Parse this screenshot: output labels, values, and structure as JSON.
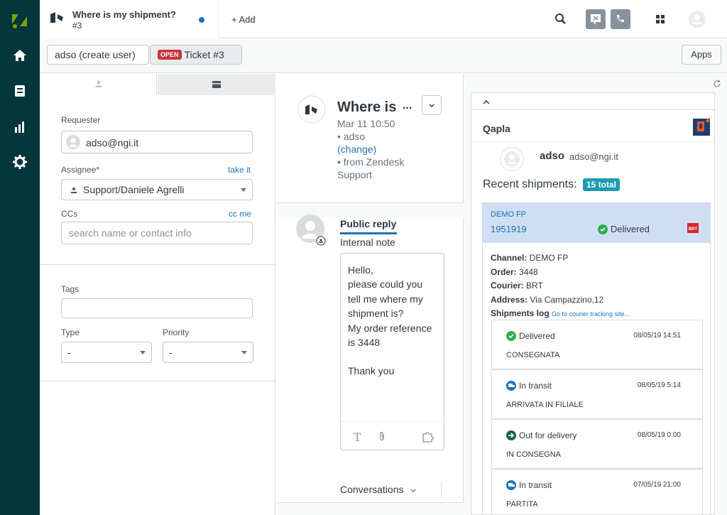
{
  "topbar": {
    "tab_title": "Where is my shipment?",
    "tab_number": "#3",
    "add_label": "+ Add"
  },
  "subbar": {
    "user_crumb": "adso (create user)",
    "open_badge": "OPEN",
    "ticket_crumb": "Ticket #3",
    "apps_label": "Apps"
  },
  "left": {
    "requester_label": "Requester",
    "requester_value": "adso@ngi.it",
    "assignee_label": "Assignee*",
    "take_it": "take it",
    "assignee_value": "Support/Daniele Agrelli",
    "ccs_label": "CCs",
    "cc_me": "cc me",
    "ccs_placeholder": "search name or contact info",
    "tags_label": "Tags",
    "type_label": "Type",
    "type_value": "-",
    "priority_label": "Priority",
    "priority_value": "-"
  },
  "middle": {
    "title": "Where is",
    "title_more": "...",
    "date": "Mar 11 10:50",
    "author": "• adso",
    "change": "(change)",
    "via": "• from Zendesk",
    "via2": "Support",
    "public_reply": "Public reply",
    "internal_note": "Internal note",
    "message_lines": [
      "Hello,",
      "please could you",
      "tell me where my",
      "shipment is?",
      "My order reference",
      "is 3448",
      "",
      "Thank you"
    ],
    "conversations": "Conversations"
  },
  "app": {
    "name": "Qapla",
    "user_name": "adso",
    "user_email": "adso@ngi.it",
    "recent_label": "Recent shipments:",
    "total_badge": "15 total",
    "shop": "DEMO FP",
    "tracking": "1951919",
    "status": "Delivered",
    "courier_logo": "BRT",
    "channel_label": "Channel:",
    "channel_value": " DEMO FP",
    "order_label": "Order:",
    "order_value": " 3448",
    "courier_label": "Courier:",
    "courier_value": " BRT",
    "address_label": "Address:",
    "address_value": " Via Campazzino,12",
    "log_label": "Shipments log",
    "log_link": "Go to courier tracking site...",
    "log": [
      {
        "status": "Delivered",
        "date": "08/05/19 14:51",
        "desc": "CONSEGNATA"
      },
      {
        "status": "In transit",
        "date": "08/05/19 5:14",
        "desc": "ARRIVATA IN FILIALE"
      },
      {
        "status": "Out for delivery",
        "date": "08/05/19 0:00",
        "desc": "IN CONSEGNA"
      },
      {
        "status": "In transit",
        "date": "07/05/19 21:00",
        "desc": "PARTITA"
      }
    ]
  },
  "colors": {
    "nav": "#03363d",
    "accent": "#1f73b7",
    "delivered": "#2eae4f",
    "transit": "#1f73b7",
    "out_for_delivery": "#186146",
    "open_badge": "#cc3340",
    "shipment_header": "#cfdef3"
  }
}
